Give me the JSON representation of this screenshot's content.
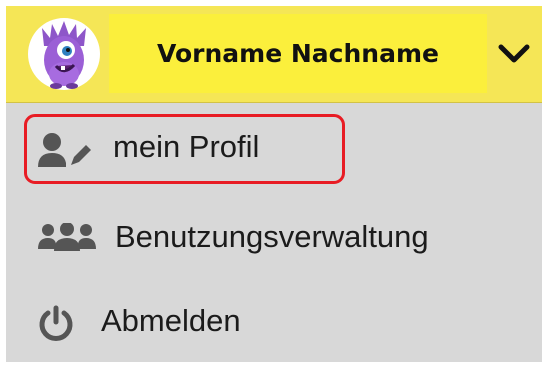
{
  "header": {
    "user_name": "Vorname Nachname",
    "avatar_icon": "purple-monster-avatar",
    "dropdown_icon": "chevron-down-icon",
    "background_color": "#f5e656",
    "name_highlight_color": "#fbef3c"
  },
  "menu": {
    "items": [
      {
        "label": "mein Profil",
        "icon": "user-edit-icon",
        "highlighted": true
      },
      {
        "label": "Benutzungsverwaltung",
        "icon": "users-group-icon",
        "highlighted": false
      },
      {
        "label": "Abmelden",
        "icon": "power-icon",
        "highlighted": false
      }
    ],
    "highlight_color": "#e81c24",
    "background_color": "#d8d8d8"
  }
}
